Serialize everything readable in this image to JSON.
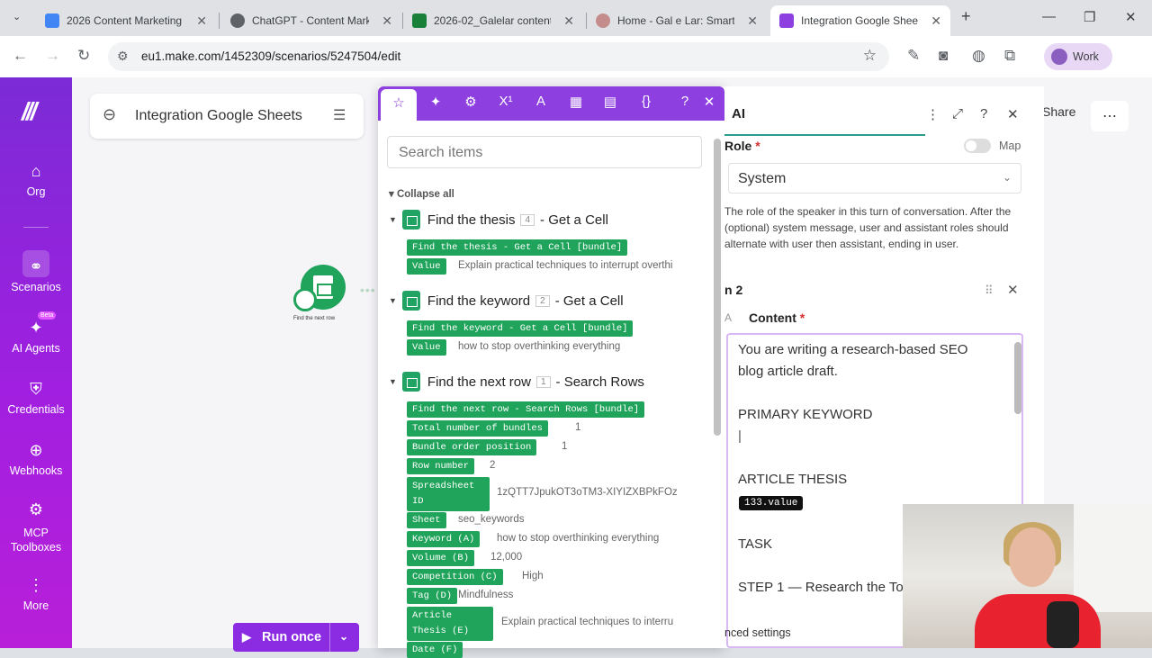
{
  "browser": {
    "tabs": [
      {
        "label": "2026 Content Marketing",
        "color": "#4285f4",
        "active": false
      },
      {
        "label": "ChatGPT - Content Marke",
        "color": "#5f6368",
        "active": false
      },
      {
        "label": "2026-02_Galelar content",
        "color": "#188038",
        "active": false
      },
      {
        "label": "Home - Gal e Lar: Smart",
        "color": "#c58c8c",
        "active": false
      },
      {
        "label": "Integration Google Sheets",
        "color": "#8e3fe0",
        "active": true
      }
    ],
    "url": "eu1.make.com/1452309/scenarios/5247504/edit",
    "profile_label": "Work"
  },
  "sidebar": {
    "items": [
      {
        "label": "Org",
        "icon": "home-icon"
      },
      {
        "label": "Scenarios",
        "icon": "share-nodes-icon"
      },
      {
        "label": "AI Agents",
        "icon": "ai-agents-icon",
        "badge": "Beta"
      },
      {
        "label": "Credentials",
        "icon": "shield-icon"
      },
      {
        "label": "Webhooks",
        "icon": "globe-icon"
      },
      {
        "label": "MCP Toolboxes",
        "icon": "mcp-icon"
      },
      {
        "label": "More",
        "icon": "more-icon"
      }
    ]
  },
  "canvas": {
    "title": "Integration Google Sheets",
    "node_label": "Find the next row",
    "run_once_label": "Run once",
    "share_label": "Share"
  },
  "mapping_panel": {
    "search_placeholder": "Search items",
    "collapse_all": "Collapse all",
    "modules": [
      {
        "name": "Find the thesis",
        "num": "4",
        "action": "- Get a Cell",
        "bundle": "Find the thesis - Get a Cell [bundle]",
        "fields": [
          {
            "key": "Value",
            "value": "Explain practical techniques to interrupt overthi"
          }
        ]
      },
      {
        "name": "Find the keyword",
        "num": "2",
        "action": "- Get a Cell",
        "bundle": "Find the keyword - Get a Cell [bundle]",
        "fields": [
          {
            "key": "Value",
            "value": "how to stop overthinking everything"
          }
        ]
      },
      {
        "name": "Find the next row",
        "num": "1",
        "action": "- Search Rows",
        "bundle": "Find the next row - Search Rows [bundle]",
        "fields": [
          {
            "key": "Total number of bundles",
            "value": "1"
          },
          {
            "key": "Bundle order position",
            "value": "1"
          },
          {
            "key": "Row number",
            "value": "2"
          },
          {
            "key": "Spreadsheet ID",
            "value": "1zQTT7JpukOT3oTM3-XIYIZXBPkFOz"
          },
          {
            "key": "Sheet",
            "value": "seo_keywords"
          },
          {
            "key": "Keyword (A)",
            "value": "how to stop overthinking everything"
          },
          {
            "key": "Volume (B)",
            "value": "12,000"
          },
          {
            "key": "Competition (C)",
            "value": "High"
          },
          {
            "key": "Tag (D)",
            "value": "Mindfulness"
          },
          {
            "key": "Article Thesis (E)",
            "value": "Explain practical techniques to interru"
          },
          {
            "key": "Date (F)",
            "value": ""
          }
        ]
      }
    ]
  },
  "module_settings": {
    "title_fragment": "AI",
    "role_label": "Role",
    "map_label": "Map",
    "role_value": "System",
    "role_help": "The role of the speaker in this turn of conversation. After the (optional) system message, user and assistant roles should alternate with user then assistant, ending in user.",
    "item_label": "n 2",
    "content_label": "Content",
    "content_lines": [
      "You are writing a research-based SEO",
      "blog article draft.",
      "PRIMARY KEYWORD",
      "ARTICLE THESIS",
      "TASK",
      "STEP 1 — Research the To"
    ],
    "content_pill": "133.value",
    "advanced_settings_fragment": "nced settings",
    "required_mark": "*"
  }
}
